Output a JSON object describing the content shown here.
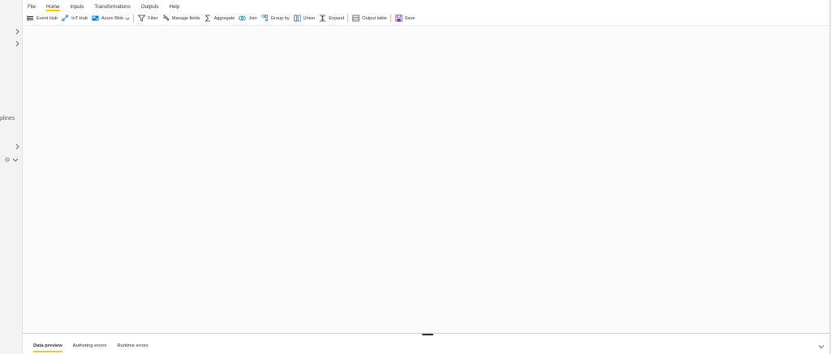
{
  "left_rail": {
    "truncated_label": "plines"
  },
  "menu": {
    "items": [
      {
        "label": "File"
      },
      {
        "label": "Home"
      },
      {
        "label": "Inputs"
      },
      {
        "label": "Transformations"
      },
      {
        "label": "Outputs"
      },
      {
        "label": "Help"
      }
    ],
    "active": "Home"
  },
  "toolbar": {
    "event_hub": "Event Hub",
    "iot_hub": "IoT Hub",
    "azure_blob": "Azure Blob",
    "filter": "Filter",
    "manage_fields": "Manage fields",
    "aggregate": "Aggregate",
    "join": "Join",
    "group_by": "Group by",
    "union": "Union",
    "expand": "Expand",
    "output_table": "Output table",
    "save": "Save"
  },
  "bottom_panel": {
    "tabs": [
      {
        "label": "Data preview"
      },
      {
        "label": "Authoring errors"
      },
      {
        "label": "Runtime errors"
      }
    ],
    "active": "Data preview"
  },
  "colors": {
    "accent": "#f2c811",
    "canvas": "#fafafa",
    "rail": "#f3f3f3"
  }
}
